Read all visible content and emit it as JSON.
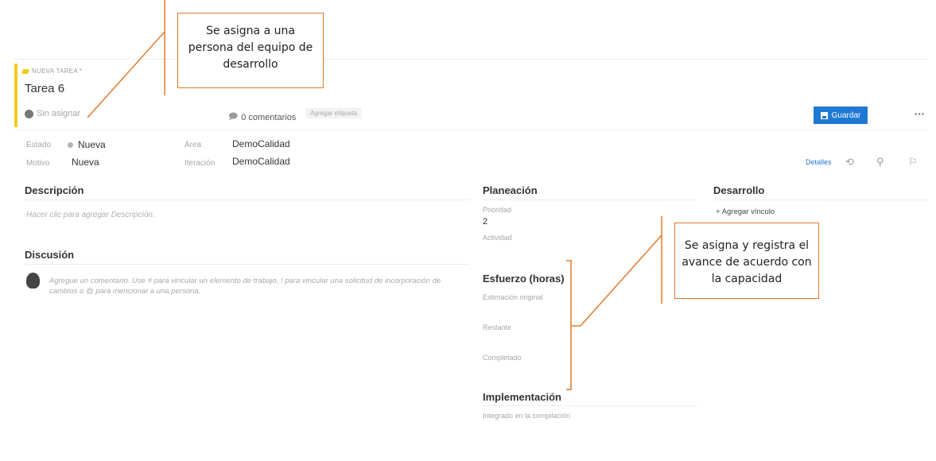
{
  "header": {
    "type_label": "NUEVA TAREA *",
    "title": "Tarea 6",
    "assigned": "Sin asignar",
    "comments": "0 comentarios",
    "add_tag": "Agregar etiqueta",
    "save_label": "Guardar",
    "more": "···"
  },
  "fields": {
    "estado_label": "Estado",
    "estado_value": "Nueva",
    "motivo_label": "Motivo",
    "motivo_value": "Nueva",
    "area_label": "Área",
    "area_value": "DemoCalidad",
    "iteracion_label": "Iteración",
    "iteracion_value": "DemoCalidad",
    "details_link": "Detalles"
  },
  "left": {
    "descripcion_title": "Descripción",
    "descripcion_placeholder": "Hacer clic para agregar Descripción.",
    "discusion_title": "Discusión",
    "discusion_placeholder": "Agregue un comentario. Use # para vincular un elemento de trabajo, ! para vincular una solicitud de incorporación de cambios o @ para mencionar a una persona."
  },
  "planning": {
    "title": "Planeación",
    "prioridad_label": "Prioridad",
    "prioridad_value": "2",
    "actividad_label": "Actividad",
    "esfuerzo_title": "Esfuerzo (horas)",
    "estimacion_label": "Estimación original",
    "restante_label": "Restante",
    "completado_label": "Completado",
    "implementacion_title": "Implementación",
    "integrado_label": "Integrado en la compilación"
  },
  "desarrollo": {
    "title": "Desarrollo",
    "add_link": "+ Agregar vínculo"
  },
  "annotations": {
    "top": "Se asigna a una persona del equipo de desarrollo",
    "right": "Se asigna y registra el avance de acuerdo con la capacidad"
  },
  "colors": {
    "task_yellow": "#f2cb1d",
    "save_blue": "#1e78d4",
    "annotation_orange": "#e07a2c"
  }
}
